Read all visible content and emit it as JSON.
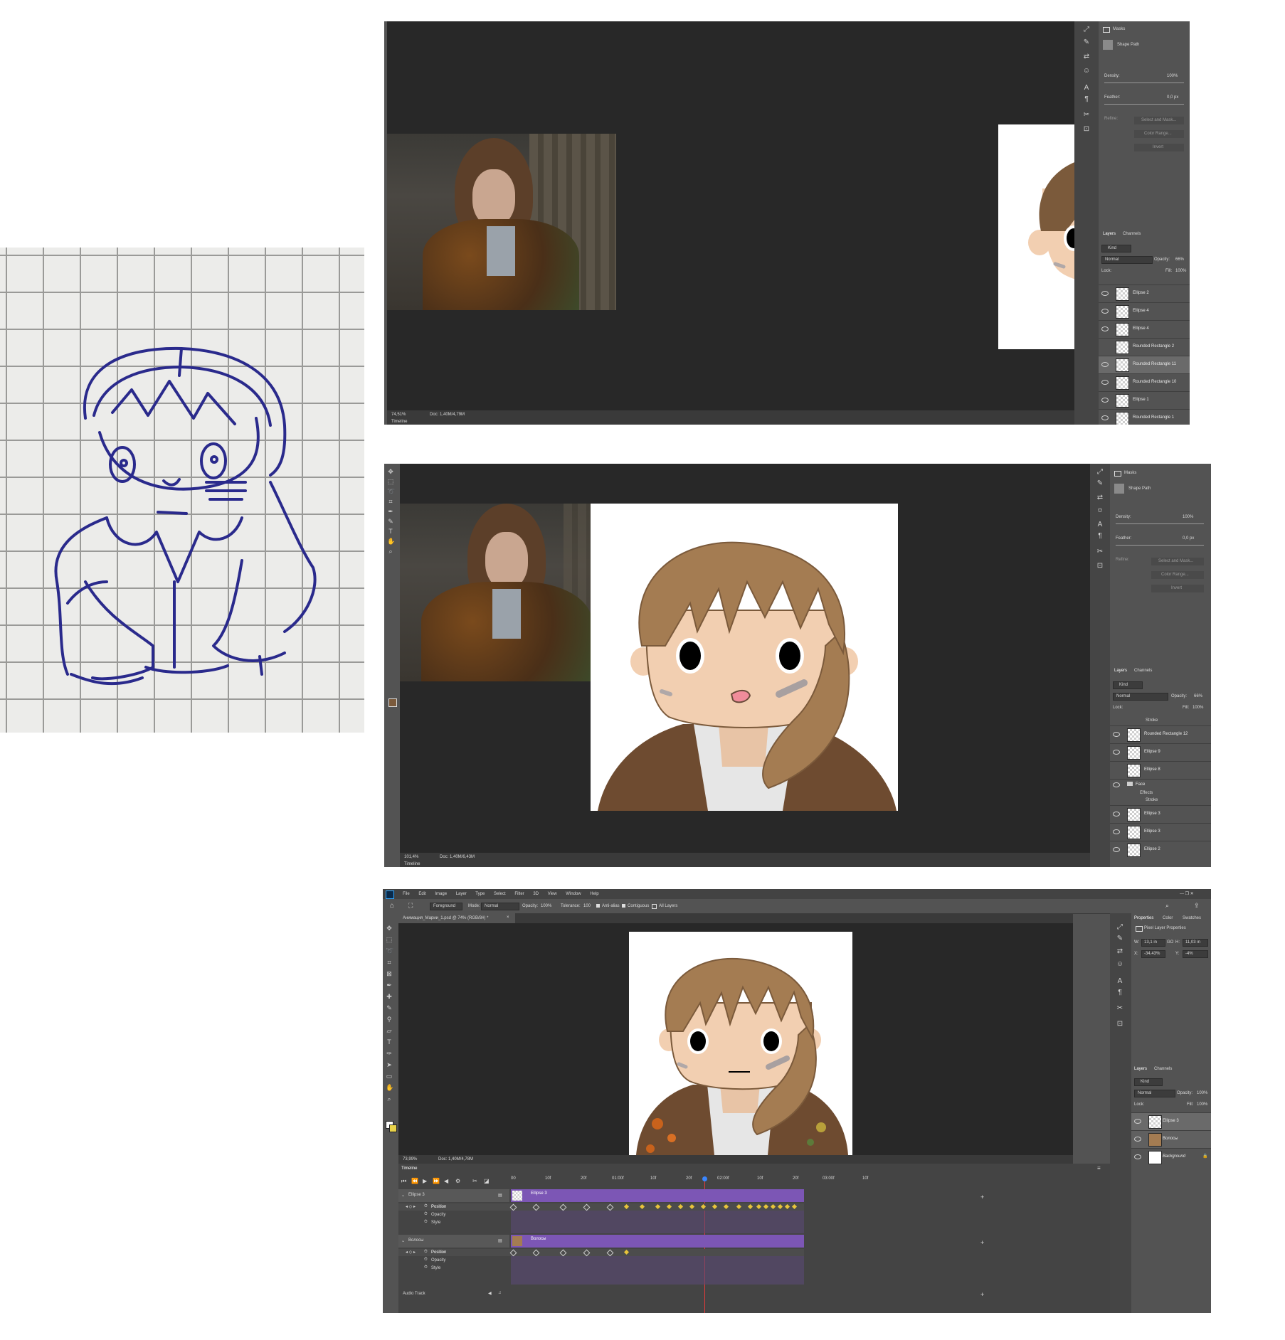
{
  "top": {
    "status_zoom": "74,51%",
    "status_doc": "Doc: 1,40M/4,79M",
    "timeline_label": "Timeline",
    "properties": {
      "masks": "Masks",
      "shape_path": "Shape Path",
      "density_label": "Density:",
      "density_value": "100%",
      "feather_label": "Feather:",
      "feather_value": "0,0 px",
      "refine_label": "Refine:",
      "select_mask": "Select and Mask...",
      "color_range": "Color Range...",
      "invert": "Invert"
    },
    "layers_panel": {
      "tab_layers": "Layers",
      "tab_channels": "Channels",
      "kind": "Kind",
      "blend": "Normal",
      "opacity_label": "Opacity:",
      "opacity": "66%",
      "lock_label": "Lock:",
      "fill_label": "Fill:",
      "fill": "100%"
    },
    "layers": [
      "Ellipse 2",
      "Ellipse 4",
      "Ellipse 4",
      "Rounded Rectangle 2",
      "Rounded Rectangle 11",
      "Rounded Rectangle 10",
      "Ellipse 1",
      "Rounded Rectangle 1"
    ]
  },
  "mid": {
    "status_zoom": "101,4%",
    "status_doc": "Doc: 1,40M/6,43M",
    "timeline_label": "Timeline",
    "properties": {
      "masks": "Masks",
      "shape_path": "Shape Path",
      "density_label": "Density:",
      "density_value": "100%",
      "feather_label": "Feather:",
      "feather_value": "0,0 px",
      "refine_label": "Refine:",
      "select_mask": "Select and Mask...",
      "color_range": "Color Range...",
      "invert": "Invert"
    },
    "layers_panel": {
      "tab_layers": "Layers",
      "tab_channels": "Channels",
      "kind": "Kind",
      "blend": "Normal",
      "opacity_label": "Opacity:",
      "opacity": "66%",
      "lock_label": "Lock:",
      "fill_label": "Fill:",
      "fill": "100%"
    },
    "layers": {
      "stroke_top": "Stroke",
      "rr12": "Rounded Rectangle 12",
      "e9": "Ellipse 9",
      "e8": "Ellipse 8",
      "face": "Face",
      "effects": "Effects",
      "stroke": "Stroke",
      "e3a": "Ellipse 3",
      "e3b": "Ellipse 3",
      "e2": "Ellipse 2"
    }
  },
  "bottom": {
    "menu": [
      "File",
      "Edit",
      "Image",
      "Layer",
      "Type",
      "Select",
      "Filter",
      "3D",
      "View",
      "Window",
      "Help"
    ],
    "options": {
      "fill_source": "Foreground",
      "mode_label": "Mode:",
      "mode": "Normal",
      "opacity_label": "Opacity:",
      "opacity": "100%",
      "tolerance_label": "Tolerance:",
      "tolerance": "100",
      "anti_alias": "Anti-alias",
      "contiguous": "Contiguous",
      "all_layers": "All Layers"
    },
    "doc_tab": "Анимация_Марии_1.psd @ 74% (RGB/8#) *",
    "status_zoom": "73,99%",
    "status_doc": "Doc: 1,40M/4,78M",
    "properties": {
      "tab_properties": "Properties",
      "tab_color": "Color",
      "tab_swatches": "Swatches",
      "pixel_layer": "Pixel Layer Properties",
      "w_label": "W:",
      "w": "13,1 in",
      "link": "GO",
      "h_label": "H:",
      "h": "11,03 in",
      "x_label": "X:",
      "x": "-34,43%",
      "y_label": "Y:",
      "y": "-4%"
    },
    "layers_panel": {
      "tab_layers": "Layers",
      "tab_channels": "Channels",
      "kind": "Kind",
      "blend": "Normal",
      "opacity_label": "Opacity:",
      "opacity": "100%",
      "lock_label": "Lock:",
      "fill_label": "Fill:",
      "fill": "100%"
    },
    "layers": [
      "Ellipse 3",
      "Волосы",
      "Background"
    ],
    "timeline": {
      "title": "Timeline",
      "ruler": [
        "00",
        "10f",
        "20f",
        "01:00f",
        "10f",
        "20f",
        "02:00f",
        "10f",
        "20f",
        "03:00f",
        "10f"
      ],
      "track1": "Ellipse 3",
      "track1_clip": "Ellipse 3",
      "track2": "Волосы",
      "track2_clip": "Волосы",
      "position": "Position",
      "opacity": "Opacity",
      "style": "Style",
      "audio": "Audio Track"
    }
  },
  "colors": {
    "hair": "#a47c52",
    "hair_dark": "#7b5a3b",
    "skin": "#f2cfb1",
    "jacket": "#6e4b30",
    "clip_purple": "#7c56b5",
    "keyframe": "#e8c43a",
    "ps_dark": "#232323",
    "ps_panel": "#535353",
    "sketch_ink": "#2a2a8c"
  }
}
